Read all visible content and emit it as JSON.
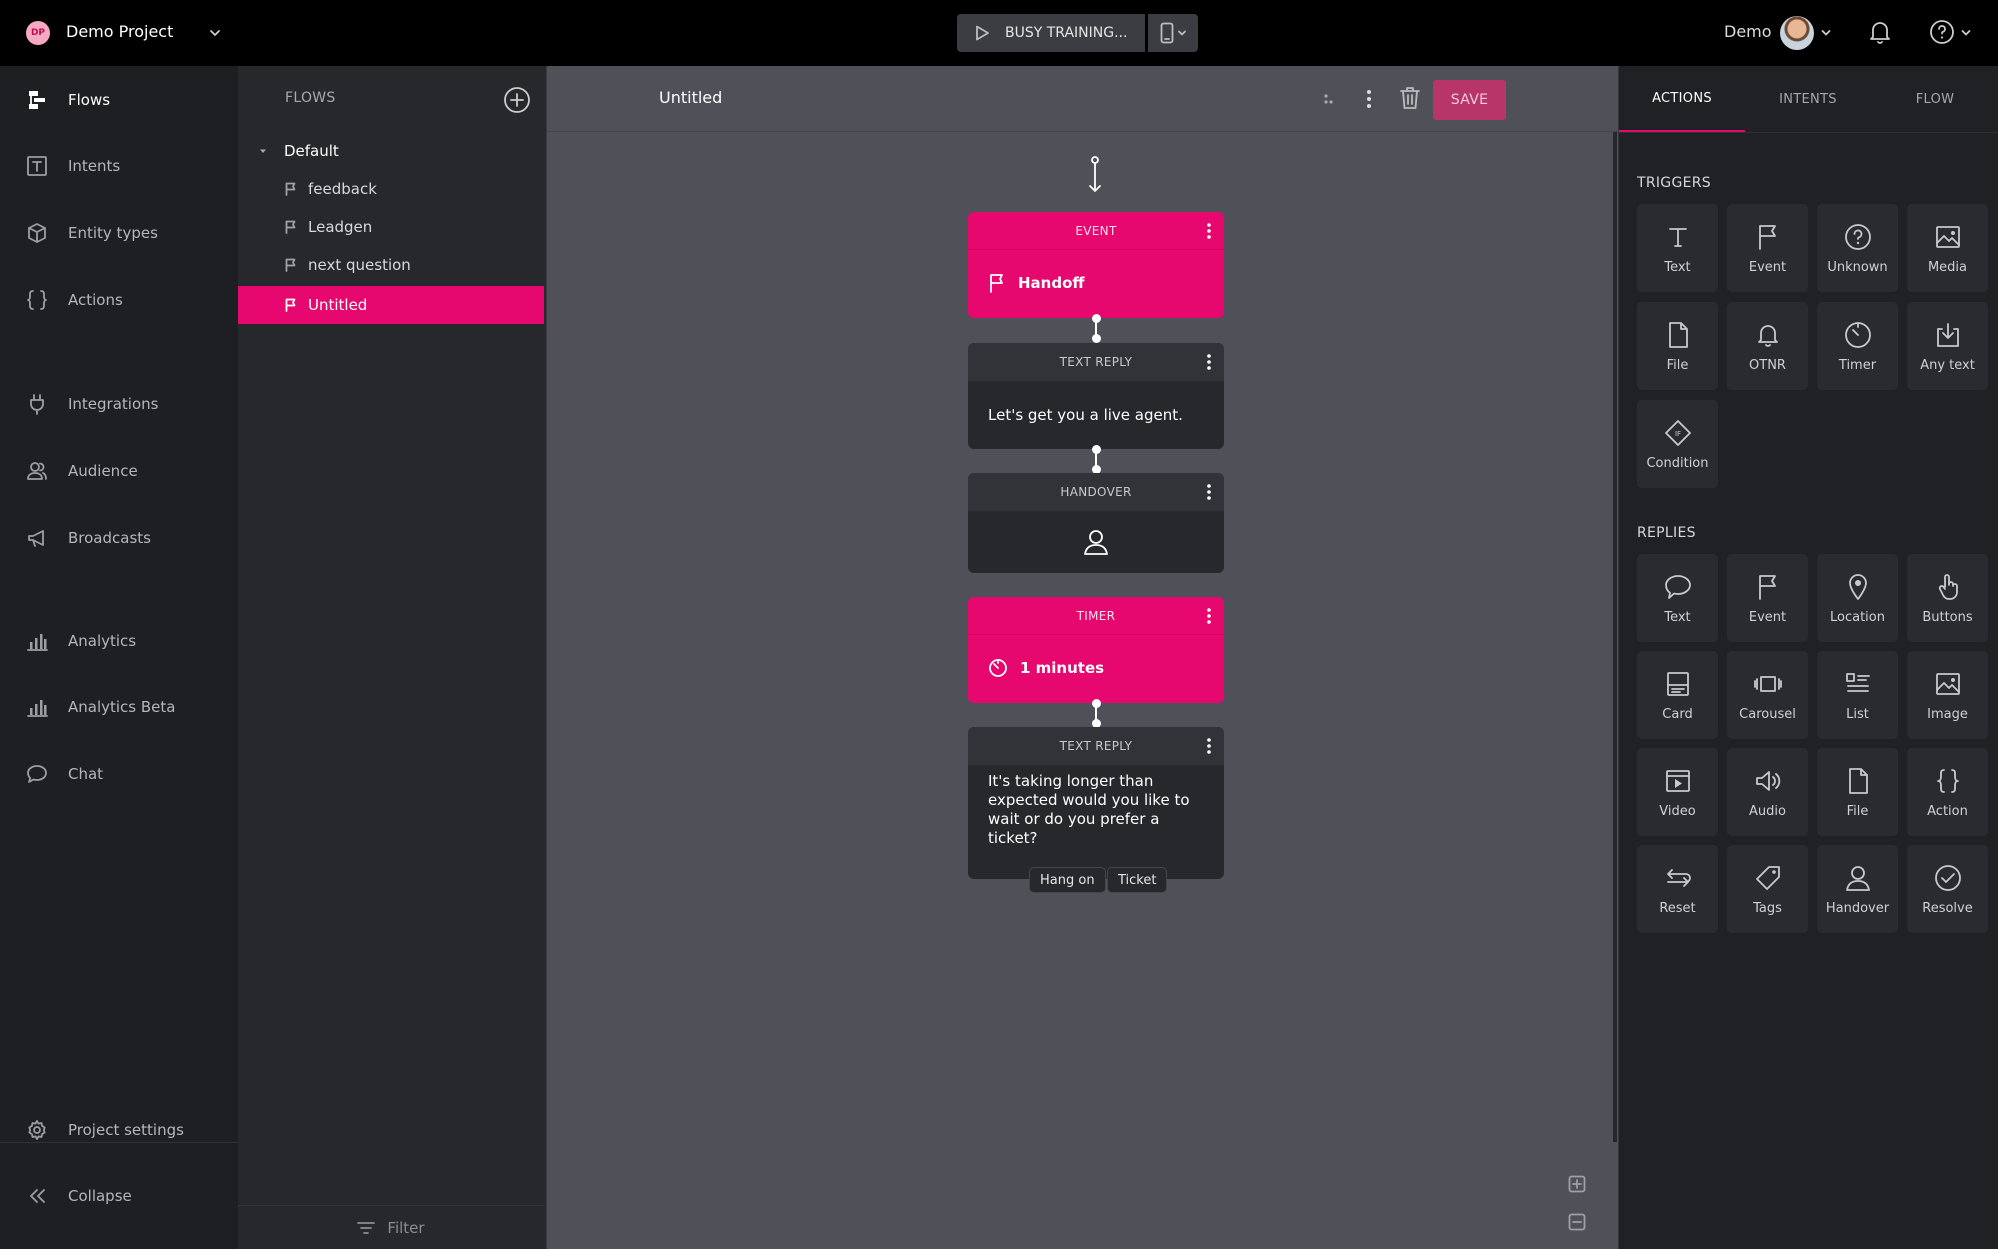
{
  "topbar": {
    "project_initials": "DP",
    "project_name": "Demo Project",
    "train_label": "BUSY TRAINING...",
    "user_name": "Demo"
  },
  "nav": {
    "items": [
      {
        "label": "Flows",
        "icon": "flows-icon"
      },
      {
        "label": "Intents",
        "icon": "text-icon"
      },
      {
        "label": "Entity types",
        "icon": "cube-icon"
      },
      {
        "label": "Actions",
        "icon": "braces-icon"
      },
      {
        "label": "Integrations",
        "icon": "plug-icon"
      },
      {
        "label": "Audience",
        "icon": "users-icon"
      },
      {
        "label": "Broadcasts",
        "icon": "megaphone-icon"
      },
      {
        "label": "Analytics",
        "icon": "bar-chart-icon"
      },
      {
        "label": "Analytics Beta",
        "icon": "bar-chart-icon"
      },
      {
        "label": "Chat",
        "icon": "chat-bubble-icon"
      }
    ],
    "settings_label": "Project settings",
    "collapse_label": "Collapse"
  },
  "flows_panel": {
    "header": "FLOWS",
    "group": "Default",
    "items": [
      "feedback",
      "Leadgen",
      "next question",
      "Untitled"
    ],
    "filter_label": "Filter"
  },
  "canvas": {
    "flow_title": "Untitled",
    "save_label": "SAVE",
    "nodes": {
      "event": {
        "type": "EVENT",
        "label": "Handoff"
      },
      "reply1": {
        "type": "TEXT REPLY",
        "text": "Let's get you a live agent."
      },
      "handover": {
        "type": "HANDOVER"
      },
      "timer": {
        "type": "TIMER",
        "label": "1 minutes"
      },
      "reply2": {
        "type": "TEXT REPLY",
        "text": "It's taking longer than expected would you like to wait or do you prefer a ticket?",
        "quick_replies": [
          "Hang on",
          "Ticket"
        ]
      }
    }
  },
  "right_panel": {
    "tabs": [
      "ACTIONS",
      "INTENTS",
      "FLOW"
    ],
    "triggers_title": "TRIGGERS",
    "triggers": [
      {
        "label": "Text",
        "icon": "text-t-icon"
      },
      {
        "label": "Event",
        "icon": "flag-icon"
      },
      {
        "label": "Unknown",
        "icon": "question-circle-icon"
      },
      {
        "label": "Media",
        "icon": "image-icon"
      },
      {
        "label": "File",
        "icon": "file-icon"
      },
      {
        "label": "OTNR",
        "icon": "bell-icon"
      },
      {
        "label": "Timer",
        "icon": "timer-icon"
      },
      {
        "label": "Any text",
        "icon": "download-icon"
      },
      {
        "label": "Condition",
        "icon": "condition-diamond-icon"
      }
    ],
    "replies_title": "REPLIES",
    "replies": [
      {
        "label": "Text",
        "icon": "speech-bubble-icon"
      },
      {
        "label": "Event",
        "icon": "flag-icon"
      },
      {
        "label": "Location",
        "icon": "location-pin-icon"
      },
      {
        "label": "Buttons",
        "icon": "pointer-hand-icon"
      },
      {
        "label": "Card",
        "icon": "card-icon"
      },
      {
        "label": "Carousel",
        "icon": "carousel-icon"
      },
      {
        "label": "List",
        "icon": "list-icon"
      },
      {
        "label": "Image",
        "icon": "image-icon"
      },
      {
        "label": "Video",
        "icon": "video-icon"
      },
      {
        "label": "Audio",
        "icon": "speaker-icon"
      },
      {
        "label": "File",
        "icon": "file-icon"
      },
      {
        "label": "Action",
        "icon": "braces-icon"
      },
      {
        "label": "Reset",
        "icon": "reset-icon"
      },
      {
        "label": "Tags",
        "icon": "tag-icon"
      },
      {
        "label": "Handover",
        "icon": "person-icon"
      },
      {
        "label": "Resolve",
        "icon": "check-circle-icon"
      }
    ]
  },
  "colors": {
    "accent": "#e6086e",
    "canvas_bg": "#4f5058",
    "panel_bg": "#27282c"
  }
}
